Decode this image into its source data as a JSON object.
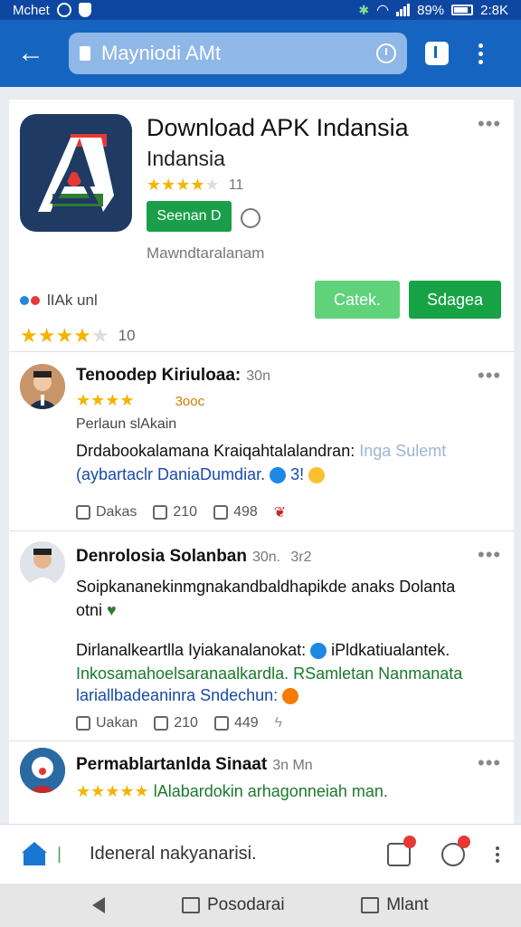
{
  "status_bar": {
    "carrier": "Mchet",
    "battery": "89%",
    "time": "2:8K",
    "icons": [
      "circle-icon",
      "shield-icon",
      "bluetooth-icon",
      "wifi-icon",
      "signal-icon",
      "battery-icon"
    ]
  },
  "toolbar": {
    "url": "Mayniodi AMt",
    "icons": [
      "back-arrow-icon",
      "lock-icon",
      "clock-icon",
      "tabs-icon",
      "more-vert-icon"
    ]
  },
  "app": {
    "title": "Download APK Indansia",
    "subtitle": "Indansia",
    "rating_count": "11",
    "stars": 4,
    "search_label": "Seenan D",
    "developer": "Mawndtaralanam",
    "meta_label": "lIAk unl",
    "rating2_count": "10",
    "btn_light": "Catek.",
    "btn_dark": "Sdagea",
    "colors": {
      "green": "#17a345",
      "light_green": "#5fd27a",
      "icon_bg": "#1f3a63"
    }
  },
  "reviews": [
    {
      "name": "Tenoodep Kiriuloaa:",
      "time": "30n",
      "stars": 4,
      "badge": "3ooc",
      "tag": "Perlaun slAkain",
      "line1": "Drdabookalamana Kraiqahtalalandran:",
      "line1_muted": "Inga Sulemt",
      "line2": "(aybartaclr DaniaDumdiar.",
      "line2_end": "3!",
      "likes": "Dakas",
      "shares": "210",
      "saves": "498"
    },
    {
      "name": "Denrolosia Solanban",
      "time": "30n.",
      "extra": "3r2",
      "line1": "Soipkananekinmgnakandbaldhapikde anaks Dolanta",
      "line2": "otni",
      "line3": "Dirlanalkeartlla Iyiakanalanokat:",
      "line3_end": "iPldkatiualantek.",
      "line4": "Inkosamahoelsaranaalkardla. RSamletan Nanmanata",
      "line5": "lariallbadeaninra Sndechun:",
      "likes": "Uakan",
      "shares": "210",
      "saves": "449"
    },
    {
      "name": "Permablartanlda Sinaat",
      "time": "3n Mn",
      "stars": 5,
      "line1": "lAlabardokin arhagonneiah man."
    }
  ],
  "bottom_bar": {
    "text": "Ideneral nakyanarisi.",
    "icons": [
      "home-icon",
      "notification-icon",
      "chat-icon",
      "more-vert-icon"
    ]
  },
  "nav_bar": {
    "item2": "Posodarai",
    "item3": "Mlant"
  }
}
